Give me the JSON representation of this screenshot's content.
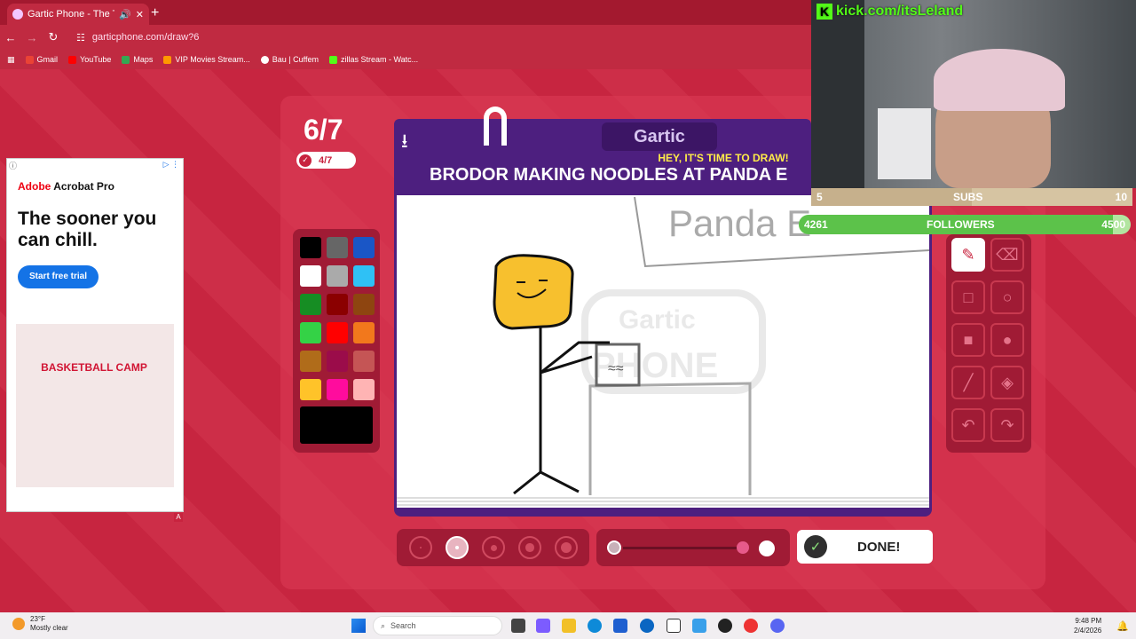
{
  "browser": {
    "tab_title": "Gartic Phone - The Telepho",
    "tab_new": "+",
    "address": "garticphone.com/draw?6",
    "nav": {
      "back": "←",
      "forward": "→",
      "reload": "↻"
    },
    "bookmarks": [
      "Gmail",
      "YouTube",
      "Maps",
      "VIP Movies Stream...",
      "Bau | Cuffem",
      "zillas Stream - Watc..."
    ]
  },
  "game": {
    "round": "6/7",
    "done_count": "4/7",
    "logo": "Gartic",
    "subtitle": "HEY, IT'S TIME TO DRAW!",
    "prompt": "BRODOR MAKING NOODLES AT PANDA E",
    "done_label": "DONE!",
    "colors": [
      "#000000",
      "#666666",
      "#1a56c6",
      "#ffffff",
      "#aaaaaa",
      "#2fc1f5",
      "#168d23",
      "#8b0000",
      "#8e4510",
      "#34d246",
      "#ff0000",
      "#f2781c",
      "#b06c1a",
      "#9b0c4a",
      "#c55555",
      "#ffc329",
      "#ff0c9d",
      "#ffb4b4"
    ],
    "current_color": "#000000",
    "tools": [
      "pencil-icon",
      "eraser-icon",
      "rectangle-outline-icon",
      "circle-outline-icon",
      "rectangle-fill-icon",
      "circle-fill-icon",
      "line-icon",
      "fill-bucket-icon",
      "undo-icon",
      "redo-icon"
    ],
    "brush_sizes": 5,
    "selected_size": 2,
    "canvas_text": "Panda E"
  },
  "ad": {
    "brand": "Adobe",
    "brand_rest": " Acrobat Pro",
    "headline": "The sooner you can chill.",
    "cta": "Start free trial",
    "image_text": "BASKETBALL CAMP"
  },
  "stream": {
    "kick_url": "kick.com/itsLeland",
    "subs_current": "5",
    "subs_label": "SUBS",
    "subs_goal": "10",
    "followers_current": "4261",
    "followers_label": "FOLLOWERS",
    "followers_goal": "4500"
  },
  "taskbar": {
    "weather_temp": "23°F",
    "weather_desc": "Mostly clear",
    "search_placeholder": "Search",
    "time": "9:48 PM",
    "date": "2/4/2026"
  }
}
